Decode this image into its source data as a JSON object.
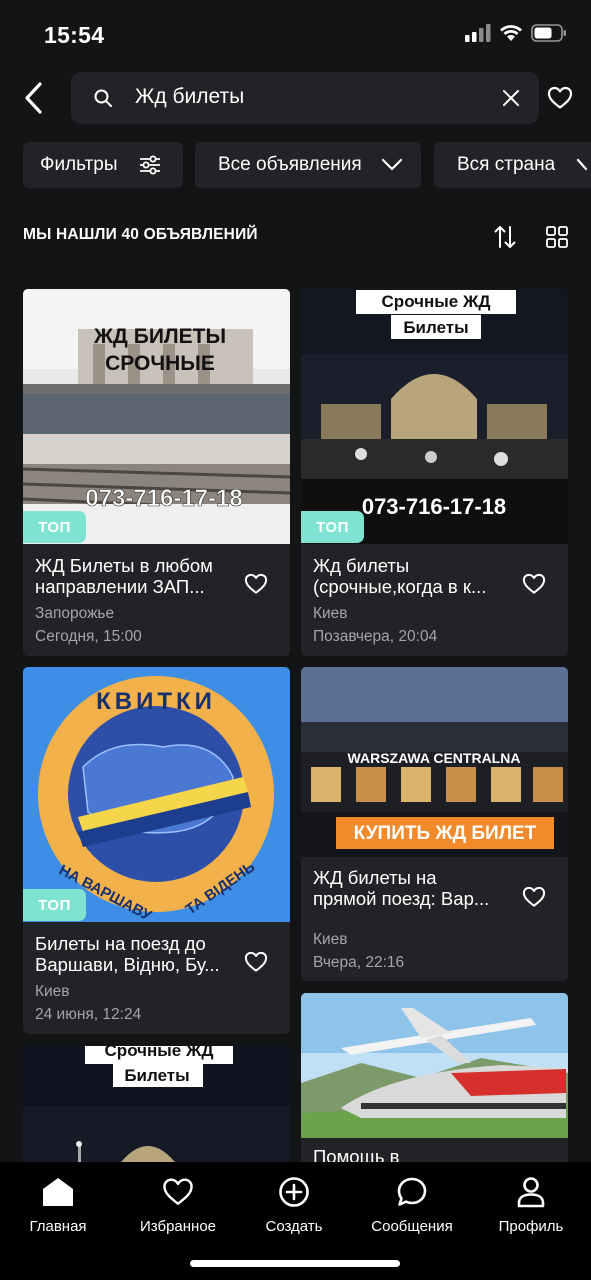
{
  "status_bar": {
    "time": "15:54"
  },
  "search": {
    "query": "Жд билеты"
  },
  "filters": {
    "filters_label": "Фильтры",
    "ads_label": "Все объявления",
    "region_label": "Вся страна"
  },
  "results": {
    "label": "МЫ НАШЛИ 40 ОБЪЯВЛЕНИЙ"
  },
  "colors": {
    "accent_top_badge": "#7fe3d2",
    "card_bg": "#222326",
    "page_bg": "#131416"
  },
  "listings": [
    {
      "badge": "ТОП",
      "title_line1": "ЖД Билеты в любом",
      "title_line2": "направлении ЗАП...",
      "city": "Запорожье",
      "date": "Сегодня, 15:00",
      "image_text_1": "ЖД БИЛЕТЫ",
      "image_text_2": "СРОЧНЫЕ",
      "image_phone": "073-716-17-18"
    },
    {
      "badge": "ТОП",
      "title_line1": "Жд билеты",
      "title_line2": "(срочные,когда в к...",
      "city": "Киев",
      "date": "Позавчера, 20:04",
      "image_text_1": "Срочные ЖД",
      "image_text_2": "Билеты",
      "image_phone": "073-716-17-18"
    },
    {
      "badge": "ТОП",
      "title_line1": "Билеты на поезд до",
      "title_line2": "Варшави, Відню, Бу...",
      "city": "Киев",
      "date": "24 июня, 12:24",
      "image_text_top": "КВИТКИ",
      "image_text_left": "НА ВАРШАВУ",
      "image_text_right": "ТА ВІДЕНЬ"
    },
    {
      "title_line1": "ЖД билеты на",
      "title_line2": "прямой поезд: Вар...",
      "city": "Киев",
      "date": "Вчера, 22:16",
      "image_text_1": "WARSZAWA CENTRALNA",
      "image_text_2": "КУПИТЬ ЖД БИЛЕТ"
    },
    {
      "image_text_1": "Срочные ЖД",
      "image_text_2": "Билеты"
    },
    {
      "title_line1": "Помощь в"
    }
  ],
  "bottom_nav": {
    "home": "Главная",
    "favorites": "Избранное",
    "create": "Создать",
    "messages": "Сообщения",
    "profile": "Профиль"
  }
}
